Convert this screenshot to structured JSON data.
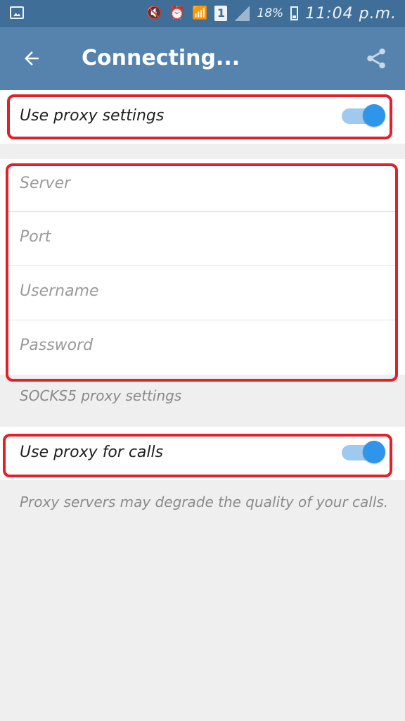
{
  "status_bar": {
    "icons": [
      "gallery-icon",
      "mute-icon",
      "alarm-icon",
      "wifi-icon",
      "sim-icon",
      "signal-icon",
      "battery-icon"
    ],
    "sim_label": "1",
    "battery_percent": "18%",
    "time": "11:04 p.m."
  },
  "appbar": {
    "title": "Connecting...",
    "back_icon": "arrow-left-icon",
    "share_icon": "share-icon",
    "color": "#5583ad"
  },
  "proxy": {
    "use_proxy_label": "Use proxy settings",
    "use_proxy_on": true
  },
  "fields": {
    "server_placeholder": "Server",
    "port_placeholder": "Port",
    "username_placeholder": "Username",
    "password_placeholder": "Password"
  },
  "socks_note": "SOCKS5 proxy settings",
  "calls": {
    "label": "Use proxy for calls",
    "on": true,
    "note": "Proxy servers may degrade the quality of your calls."
  },
  "colors": {
    "accent": "#2f95ea",
    "highlight": "#e0202a"
  }
}
